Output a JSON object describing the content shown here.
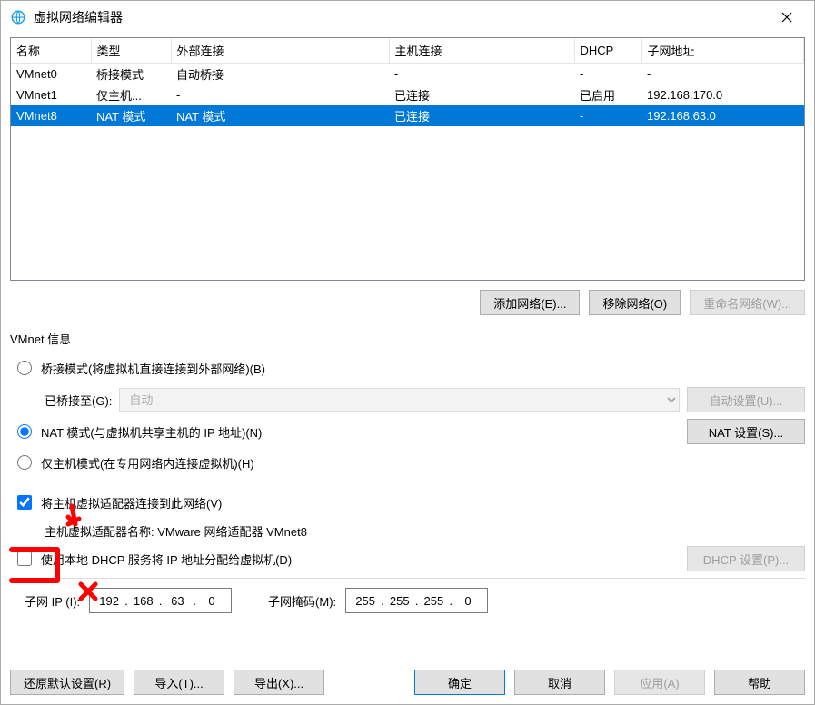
{
  "window": {
    "title": "虚拟网络编辑器"
  },
  "table": {
    "headers": [
      "名称",
      "类型",
      "外部连接",
      "主机连接",
      "DHCP",
      "子网地址"
    ],
    "rows": [
      {
        "cells": [
          "VMnet0",
          "桥接模式",
          "自动桥接",
          "-",
          "-",
          "-"
        ],
        "selected": false
      },
      {
        "cells": [
          "VMnet1",
          "仅主机...",
          "-",
          "已连接",
          "已启用",
          "192.168.170.0"
        ],
        "selected": false
      },
      {
        "cells": [
          "VMnet8",
          "NAT 模式",
          "NAT 模式",
          "已连接",
          "-",
          "192.168.63.0"
        ],
        "selected": true
      }
    ]
  },
  "btns_under_table": {
    "add": "添加网络(E)...",
    "remove": "移除网络(O)",
    "rename": "重命名网络(W)..."
  },
  "group": {
    "legend": "VMnet 信息",
    "bridge": {
      "radio": "桥接模式(将虚拟机直接连接到外部网络)(B)",
      "bridged_to_label": "已桥接至(G):",
      "bridged_to_value": "自动",
      "auto_btn": "自动设置(U)..."
    },
    "nat": {
      "radio": "NAT 模式(与虚拟机共享主机的 IP 地址)(N)",
      "btn": "NAT 设置(S)..."
    },
    "hostonly": {
      "radio": "仅主机模式(在专用网络内连接虚拟机)(H)"
    },
    "connect_host": {
      "check": "将主机虚拟适配器连接到此网络(V)",
      "adapter_label": "主机虚拟适配器名称: VMware 网络适配器 VMnet8"
    },
    "dhcp": {
      "check": "使用本地 DHCP 服务将 IP 地址分配给虚拟机(D)",
      "btn": "DHCP 设置(P)..."
    },
    "subnet": {
      "ip_label": "子网 IP (I):",
      "ip": [
        "192",
        "168",
        "63",
        "0"
      ],
      "mask_label": "子网掩码(M):",
      "mask": [
        "255",
        "255",
        "255",
        "0"
      ]
    }
  },
  "bottom": {
    "restore": "还原默认设置(R)",
    "import": "导入(T)...",
    "export": "导出(X)...",
    "ok": "确定",
    "cancel": "取消",
    "apply": "应用(A)",
    "help": "帮助"
  }
}
